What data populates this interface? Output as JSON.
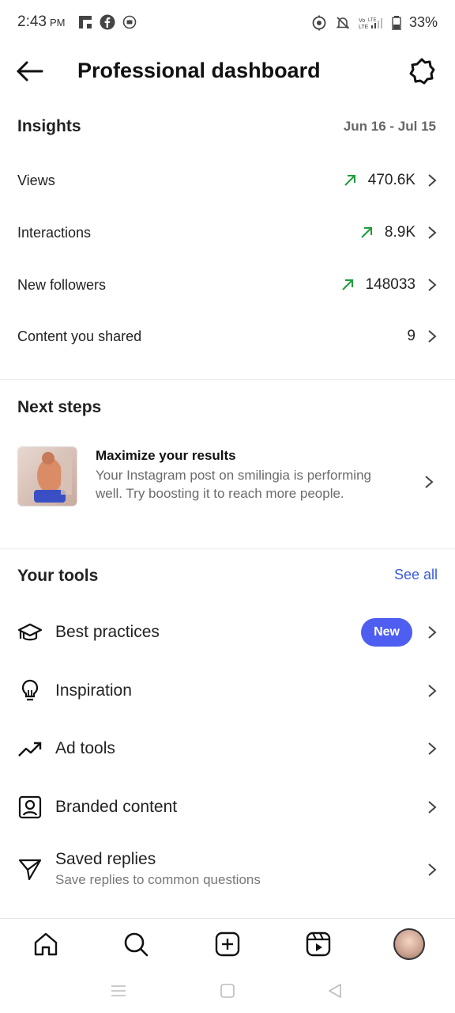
{
  "status_bar": {
    "time": "2:43",
    "ampm": "PM",
    "battery": "33%",
    "left_icons": [
      "flipboard-icon",
      "facebook-icon",
      "record-icon"
    ],
    "right_icons": [
      "location-icon",
      "mute-icon",
      "volte-lte-icon",
      "signal-icon",
      "battery-icon"
    ]
  },
  "header": {
    "title": "Professional dashboard",
    "back_icon": "arrow-left-icon",
    "settings_icon": "gear-icon"
  },
  "insights": {
    "title": "Insights",
    "date_range": "Jun 16 - Jul 15",
    "metrics": [
      {
        "label": "Views",
        "value": "470.6K",
        "trend": "up"
      },
      {
        "label": "Interactions",
        "value": "8.9K",
        "trend": "up"
      },
      {
        "label": "New followers",
        "value": "148033",
        "trend": "up"
      },
      {
        "label": "Content you shared",
        "value": "9",
        "trend": "none"
      }
    ],
    "trend_color": "#1f9d3a"
  },
  "next_steps": {
    "title": "Next steps",
    "card": {
      "title": "Maximize your results",
      "description": "Your Instagram post on smilingia is performing well. Try boosting it to reach more people."
    }
  },
  "tools": {
    "title": "Your tools",
    "see_all": "See all",
    "items": [
      {
        "label": "Best practices",
        "icon": "graduation-cap-icon",
        "badge": "New"
      },
      {
        "label": "Inspiration",
        "icon": "lightbulb-icon"
      },
      {
        "label": "Ad tools",
        "icon": "trending-up-icon"
      },
      {
        "label": "Branded content",
        "icon": "person-badge-icon"
      },
      {
        "label": "Saved replies",
        "icon": "paper-plane-icon",
        "subtitle": "Save replies to common questions"
      }
    ],
    "accent_color": "#4d5ef0"
  },
  "bottom_nav": {
    "items": [
      "home-icon",
      "search-icon",
      "create-icon",
      "reels-icon",
      "profile-avatar"
    ]
  },
  "system_nav": {
    "items": [
      "recents-icon",
      "home-square-icon",
      "back-triangle-icon"
    ]
  }
}
